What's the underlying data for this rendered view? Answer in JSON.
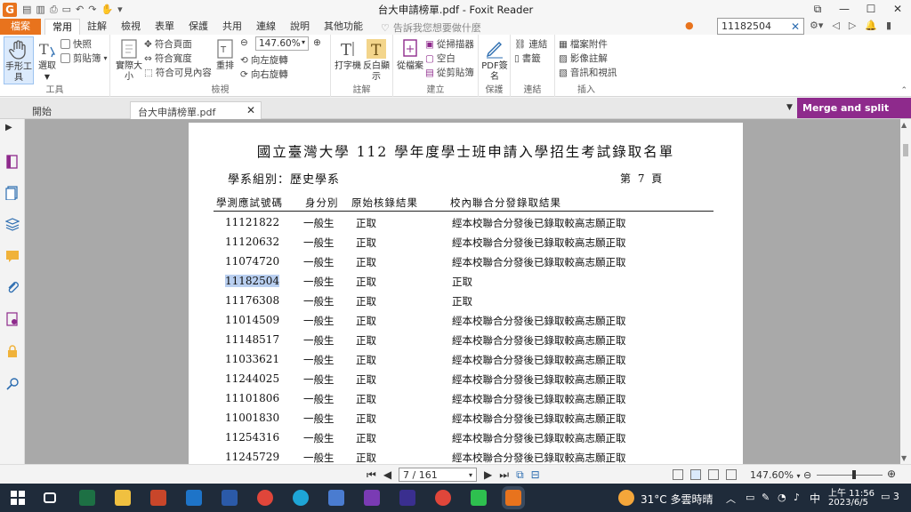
{
  "window": {
    "title": "台大申請榜單.pdf - Foxit Reader",
    "controls": [
      "⧉",
      "—",
      "☐",
      "✕"
    ]
  },
  "ribbon_tabs": {
    "file": "檔案",
    "tabs": [
      "常用",
      "註解",
      "檢視",
      "表單",
      "保護",
      "共用",
      "連線",
      "說明",
      "其他功能"
    ],
    "tell_me": "告訴我您想要做什麼"
  },
  "search": {
    "value": "11182504"
  },
  "ribbon": {
    "tools": {
      "hand": "手形工具",
      "select": "選取",
      "snapshot": "快照",
      "clipboard": "剪貼簿",
      "label": "工具"
    },
    "view": {
      "actual_size": "實際大小",
      "fit_page": "符合頁面",
      "fit_width": "符合寬度",
      "fit_visible": "符合可見內容",
      "reflow": "重排",
      "zoom": "147.60%",
      "rotate_left": "向左旋轉",
      "rotate_right": "向右旋轉",
      "label": "檢視"
    },
    "comment": {
      "typewriter": "打字機",
      "highlight": "反白顯示",
      "label": "註解"
    },
    "create": {
      "from_file": "從檔案",
      "from_scanner": "從掃描器",
      "blank": "空白",
      "from_clipboard": "從剪貼簿",
      "label": "建立"
    },
    "protect": {
      "pdf_sign": "PDF簽名",
      "label": "保護"
    },
    "links": {
      "link": "連結",
      "bookmark": "書籤",
      "label": "連結"
    },
    "insert": {
      "attachment": "檔案附件",
      "image": "影像註解",
      "audio_video": "音訊和視訊",
      "label": "插入"
    }
  },
  "doc_tabs": {
    "start": "開始",
    "file": "台大申請榜單.pdf",
    "merge": "Merge and split PDFs"
  },
  "page": {
    "title": "國立臺灣大學 112 學年度學士班申請入學招生考試錄取名單",
    "group": "學系組別：歷史學系",
    "page_num": "第 7 頁",
    "headers": [
      "學測應試號碼",
      "身分別",
      "原始核錄結果",
      "校內聯合分發錄取結果"
    ],
    "rows": [
      {
        "id": "11121822",
        "type": "一般生",
        "orig": "正取",
        "result": "經本校聯合分發後已錄取較高志願正取"
      },
      {
        "id": "11120632",
        "type": "一般生",
        "orig": "正取",
        "result": "經本校聯合分發後已錄取較高志願正取"
      },
      {
        "id": "11074720",
        "type": "一般生",
        "orig": "正取",
        "result": "經本校聯合分發後已錄取較高志願正取"
      },
      {
        "id": "11182504",
        "type": "一般生",
        "orig": "正取",
        "result": "正取"
      },
      {
        "id": "11176308",
        "type": "一般生",
        "orig": "正取",
        "result": "正取"
      },
      {
        "id": "11014509",
        "type": "一般生",
        "orig": "正取",
        "result": "經本校聯合分發後已錄取較高志願正取"
      },
      {
        "id": "11148517",
        "type": "一般生",
        "orig": "正取",
        "result": "經本校聯合分發後已錄取較高志願正取"
      },
      {
        "id": "11033621",
        "type": "一般生",
        "orig": "正取",
        "result": "經本校聯合分發後已錄取較高志願正取"
      },
      {
        "id": "11244025",
        "type": "一般生",
        "orig": "正取",
        "result": "經本校聯合分發後已錄取較高志願正取"
      },
      {
        "id": "11101806",
        "type": "一般生",
        "orig": "正取",
        "result": "經本校聯合分發後已錄取較高志願正取"
      },
      {
        "id": "11001830",
        "type": "一般生",
        "orig": "正取",
        "result": "經本校聯合分發後已錄取較高志願正取"
      },
      {
        "id": "11254316",
        "type": "一般生",
        "orig": "正取",
        "result": "經本校聯合分發後已錄取較高志願正取"
      },
      {
        "id": "11245729",
        "type": "一般生",
        "orig": "正取",
        "result": "經本校聯合分發後已錄取較高志願正取"
      }
    ]
  },
  "status": {
    "page_indicator": "7 / 161",
    "zoom": "147.60%"
  },
  "taskbar": {
    "weather": "31°C 多雲時晴",
    "ime": "中",
    "time": "上午 11:56",
    "date": "2023/6/5",
    "notifications": "3"
  },
  "colors": {
    "foxit_orange": "#e8731d",
    "merge_purple": "#8e2a8c",
    "highlight": "#b9cff0",
    "taskbar": "#1f2b3a"
  }
}
